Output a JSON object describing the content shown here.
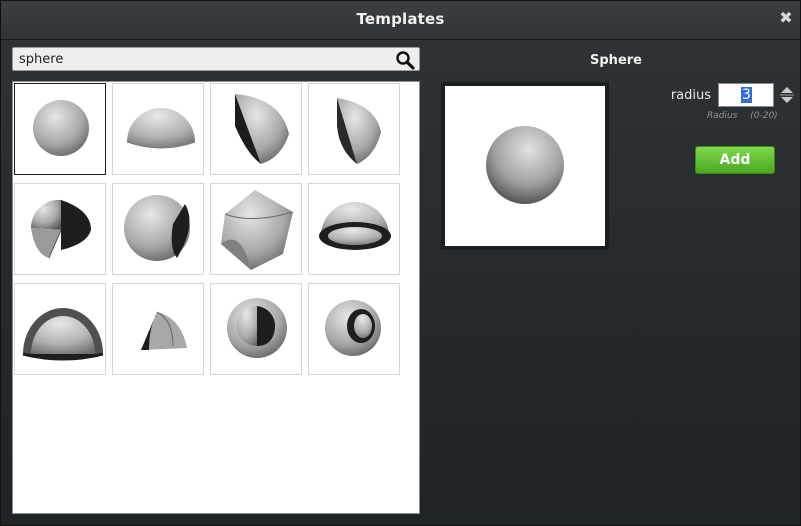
{
  "window": {
    "title": "Templates",
    "close_icon": "close-icon"
  },
  "search": {
    "value": "sphere",
    "icon": "search-icon"
  },
  "templates": [
    {
      "name": "sphere",
      "selected": true
    },
    {
      "name": "hemisphere"
    },
    {
      "name": "sphere-segment-tall"
    },
    {
      "name": "sphere-segment-slice"
    },
    {
      "name": "sphere-cut-quarter"
    },
    {
      "name": "sphere-cut-flat"
    },
    {
      "name": "sphere-rounded-cube"
    },
    {
      "name": "hemisphere-bowl"
    },
    {
      "name": "half-shell"
    },
    {
      "name": "eighth-sphere"
    },
    {
      "name": "shell-cutaway"
    },
    {
      "name": "hollow-sphere-ring"
    }
  ],
  "detail": {
    "title": "Sphere",
    "param_label": "radius",
    "param_value": "3",
    "param_hint_name": "Radius",
    "param_hint_range": "(0-20)",
    "add_label": "Add"
  },
  "colors": {
    "accent": "#4aa820",
    "selection": "#2f6fd6"
  }
}
